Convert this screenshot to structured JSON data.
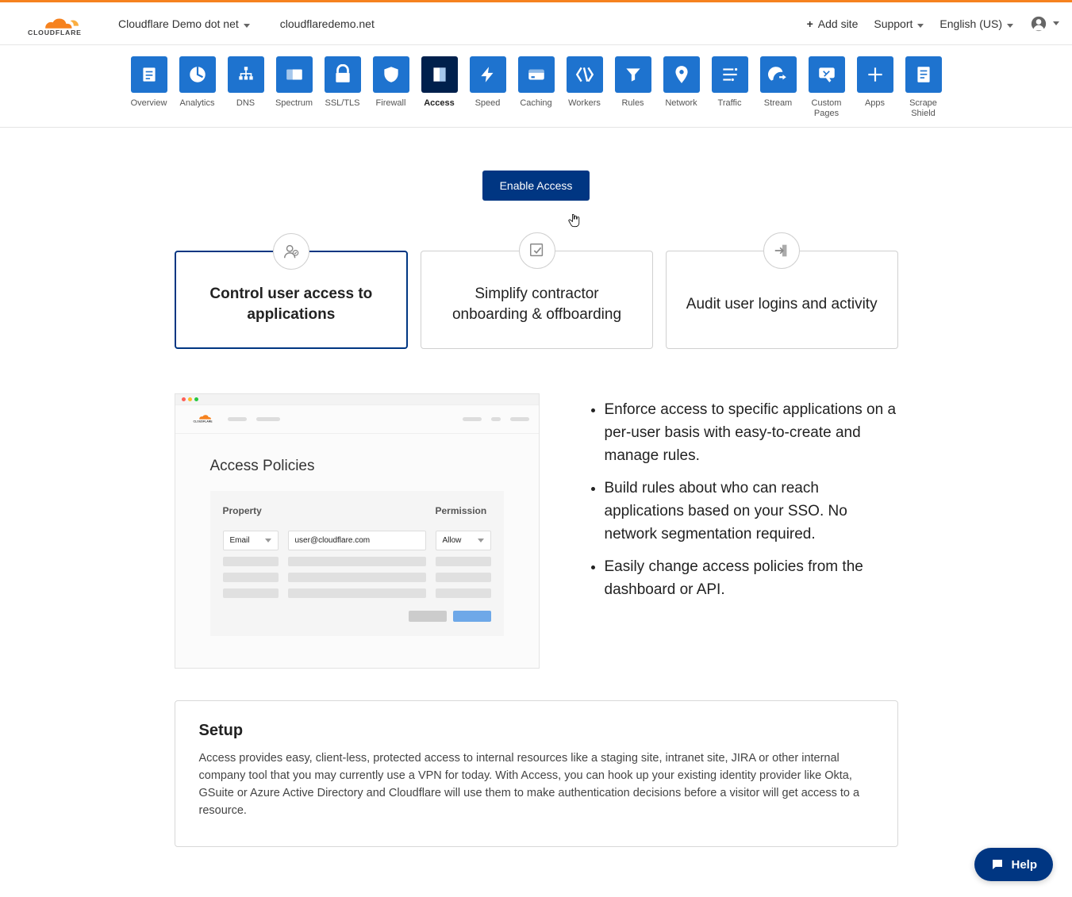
{
  "header": {
    "account": "Cloudflare Demo dot net",
    "domain": "cloudflaredemo.net",
    "addSite": "Add site",
    "support": "Support",
    "language": "English (US)"
  },
  "nav": {
    "items": [
      "Overview",
      "Analytics",
      "DNS",
      "Spectrum",
      "SSL/TLS",
      "Firewall",
      "Access",
      "Speed",
      "Caching",
      "Workers",
      "Rules",
      "Network",
      "Traffic",
      "Stream",
      "Custom Pages",
      "Apps",
      "Scrape Shield"
    ],
    "activeIndex": 6
  },
  "enableButton": "Enable Access",
  "features": [
    {
      "title": "Control user access to applications"
    },
    {
      "title": "Simplify contractor onboarding & offboarding"
    },
    {
      "title": "Audit user logins and activity"
    }
  ],
  "mockup": {
    "title": "Access Policies",
    "propertyHeader": "Property",
    "permissionHeader": "Permission",
    "propertyValue": "Email",
    "emailValue": "user@cloudflare.com",
    "permissionValue": "Allow"
  },
  "bullets": [
    "Enforce access to specific applications on a per-user basis with easy-to-create and manage rules.",
    "Build rules about who can reach applications based on your SSO. No network segmentation required.",
    "Easily change access policies from the dashboard or API."
  ],
  "setup": {
    "title": "Setup",
    "text": "Access provides easy, client-less, protected access to internal resources like a staging site, intranet site, JIRA or other internal company tool that you may currently use a VPN for today. With Access, you can hook up your existing identity provider like Okta, GSuite or Azure Active Directory and Cloudflare will use them to make authentication decisions before a visitor will get access to a resource."
  },
  "help": "Help"
}
